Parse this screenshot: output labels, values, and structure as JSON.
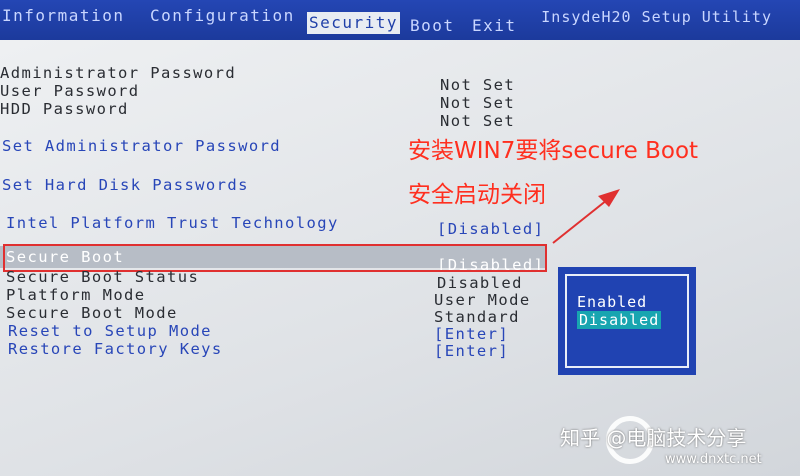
{
  "menu": {
    "tabs": [
      {
        "label": "Information"
      },
      {
        "label": "Configuration"
      },
      {
        "label": "Security"
      },
      {
        "label": "Boot"
      },
      {
        "label": "Exit"
      }
    ],
    "app_title": "InsydeH20 Setup Utility"
  },
  "passwords": [
    {
      "label": "Administrator Password",
      "value": "Not Set"
    },
    {
      "label": "User Password",
      "value": "Not Set"
    },
    {
      "label": "HDD Password",
      "value": "Not Set"
    }
  ],
  "actions": {
    "set_admin": "Set Administrator Password",
    "set_hdd": "Set Hard Disk Passwords"
  },
  "ptt": {
    "label": "Intel Platform Trust Technology",
    "value": "[Disabled]"
  },
  "secure_boot": {
    "label": "Secure Boot",
    "value": "[Disabled]"
  },
  "status": [
    {
      "label": "Secure Boot Status",
      "value": "Disabled"
    },
    {
      "label": "Platform Mode",
      "value": "User Mode"
    },
    {
      "label": "Secure Boot Mode",
      "value": "Standard"
    }
  ],
  "reset": {
    "label": "Reset to Setup Mode",
    "value": "[Enter]"
  },
  "restore": {
    "label": "Restore Factory Keys",
    "value": "[Enter]"
  },
  "popup": {
    "options": [
      "Enabled",
      "Disabled"
    ],
    "selected": "Disabled"
  },
  "annotation": {
    "line1": "安装WIN7要将secure Boot",
    "line2": "安全启动关闭"
  },
  "watermark": {
    "text": "知乎 @电脑技术分享",
    "url": "www.dnxtc.net"
  },
  "colors": {
    "menu_bg": "#1f3fa8",
    "label_blue": "#2846b8",
    "annotation_red": "#ff2f1f",
    "popup_bg": "#2043b2",
    "popup_selected": "#18a5b0"
  }
}
